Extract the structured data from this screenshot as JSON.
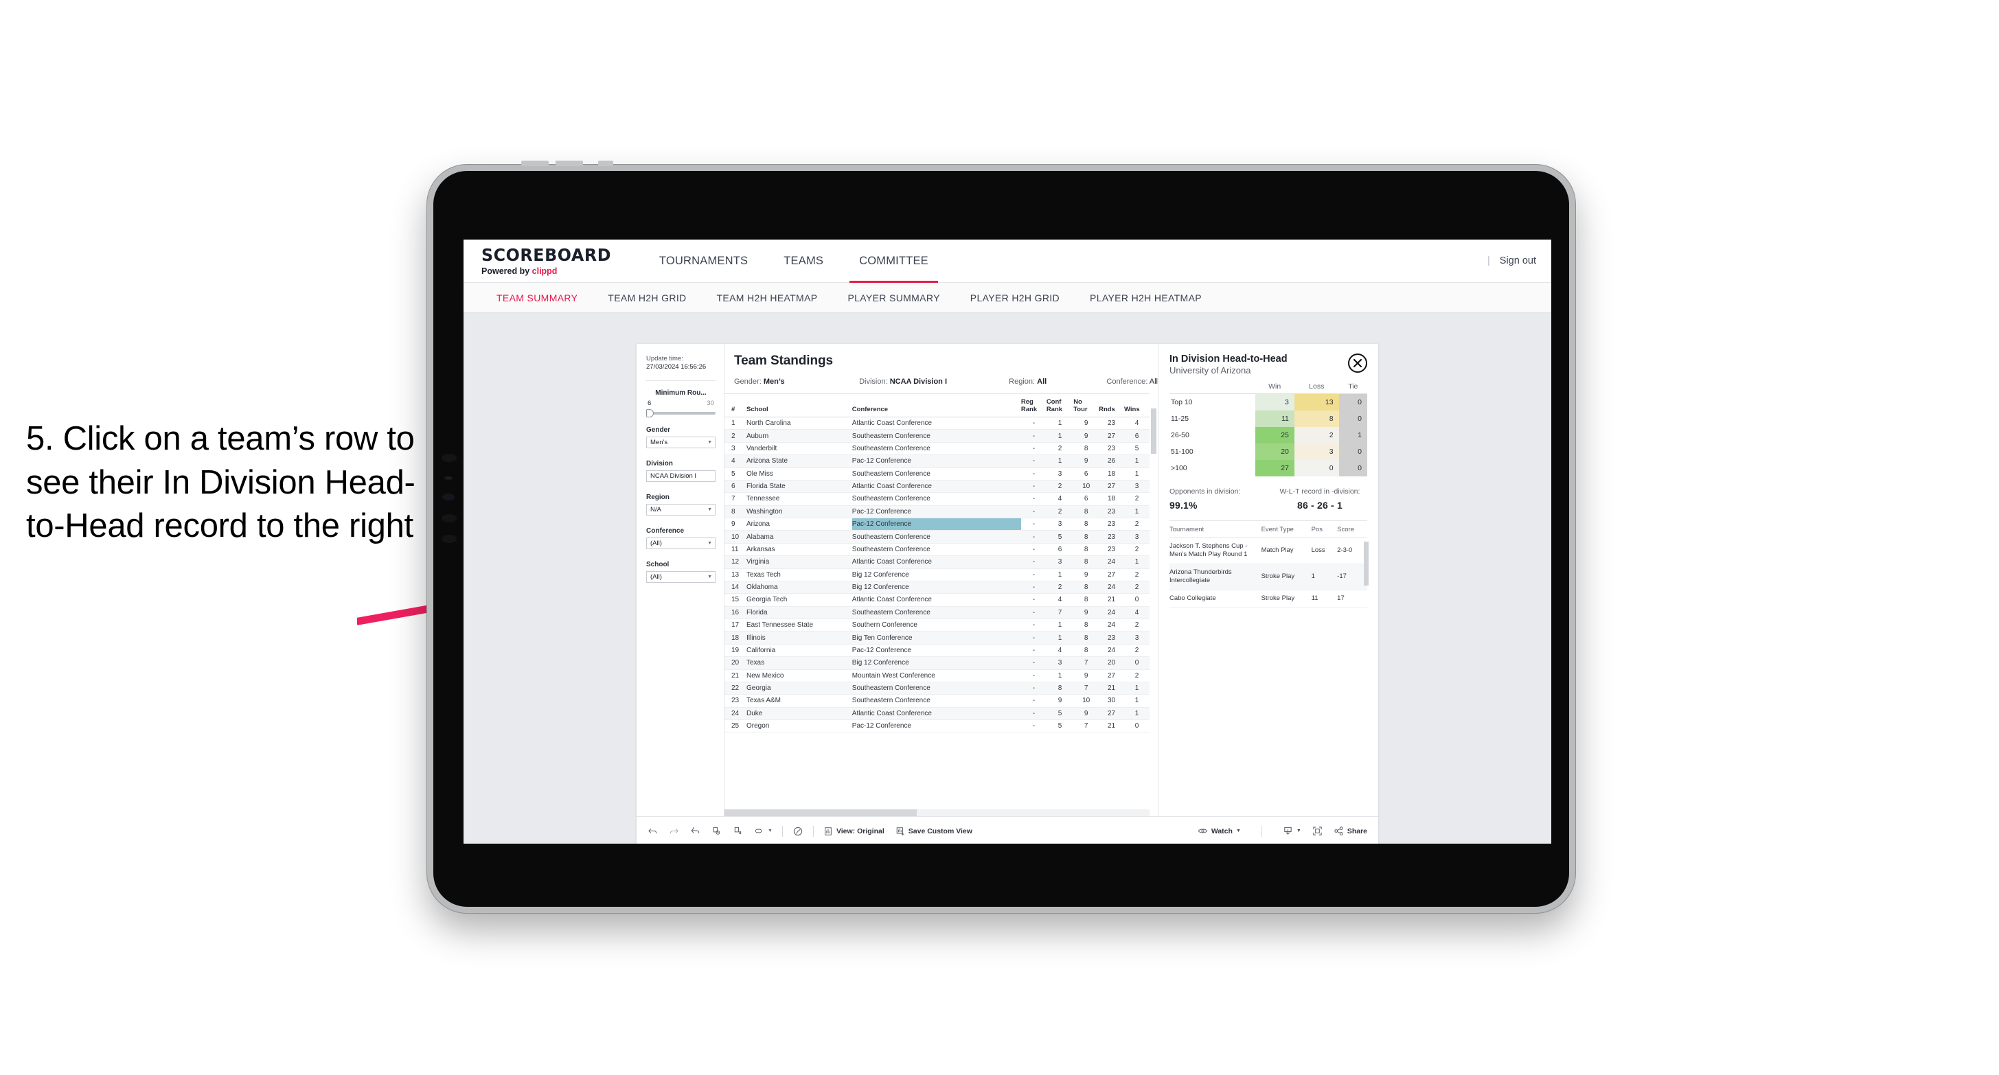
{
  "annotation": {
    "text": "5. Click on a team’s row to see their In Division Head-to-Head record to the right",
    "arrow_color": "#ef2060"
  },
  "app": {
    "brand": {
      "title": "SCOREBOARD",
      "powered_prefix": "Powered by ",
      "powered_brand": "clippd"
    },
    "main_nav": [
      {
        "label": "TOURNAMENTS",
        "active": false
      },
      {
        "label": "TEAMS",
        "active": false
      },
      {
        "label": "COMMITTEE",
        "active": true
      }
    ],
    "sign_out": "Sign out",
    "sub_nav": [
      {
        "label": "TEAM SUMMARY",
        "active": true
      },
      {
        "label": "TEAM H2H GRID",
        "active": false
      },
      {
        "label": "TEAM H2H HEATMAP",
        "active": false
      },
      {
        "label": "PLAYER SUMMARY",
        "active": false
      },
      {
        "label": "PLAYER H2H GRID",
        "active": false
      },
      {
        "label": "PLAYER H2H HEATMAP",
        "active": false
      }
    ],
    "accent": "#e8194b"
  },
  "filters": {
    "update_time_label": "Update time:",
    "update_time_value": "27/03/2024 16:56:26",
    "minimum_rounds": {
      "label": "Minimum Rou...",
      "min": "6",
      "max": "30",
      "value": 6
    },
    "gender": {
      "label": "Gender",
      "value": "Men’s"
    },
    "division": {
      "label": "Division",
      "value": "NCAA Division I"
    },
    "region": {
      "label": "Region",
      "value": "N/A"
    },
    "conference": {
      "label": "Conference",
      "value": "(All)"
    },
    "school": {
      "label": "School",
      "value": "(All)"
    }
  },
  "standings": {
    "title": "Team Standings",
    "meta": {
      "gender_label": "Gender: ",
      "gender_value": "Men’s",
      "division_label": "Division: ",
      "division_value": "NCAA Division I",
      "region_label": "Region: ",
      "region_value": "All",
      "conference_label": "Conference: ",
      "conference_value": "All"
    },
    "columns": [
      "#",
      "School",
      "Conference",
      "Reg Rank",
      "Conf Rank",
      "No Tour",
      "Rnds",
      "Wins"
    ],
    "selected_row_index": 8,
    "rows": [
      {
        "rank": "1",
        "school": "North Carolina",
        "conference": "Atlantic Coast Conference",
        "reg_rank": "-",
        "conf_rank": "1",
        "no_tour": "9",
        "rnds": "23",
        "wins": "4"
      },
      {
        "rank": "2",
        "school": "Auburn",
        "conference": "Southeastern Conference",
        "reg_rank": "-",
        "conf_rank": "1",
        "no_tour": "9",
        "rnds": "27",
        "wins": "6"
      },
      {
        "rank": "3",
        "school": "Vanderbilt",
        "conference": "Southeastern Conference",
        "reg_rank": "-",
        "conf_rank": "2",
        "no_tour": "8",
        "rnds": "23",
        "wins": "5"
      },
      {
        "rank": "4",
        "school": "Arizona State",
        "conference": "Pac-12 Conference",
        "reg_rank": "-",
        "conf_rank": "1",
        "no_tour": "9",
        "rnds": "26",
        "wins": "1"
      },
      {
        "rank": "5",
        "school": "Ole Miss",
        "conference": "Southeastern Conference",
        "reg_rank": "-",
        "conf_rank": "3",
        "no_tour": "6",
        "rnds": "18",
        "wins": "1"
      },
      {
        "rank": "6",
        "school": "Florida State",
        "conference": "Atlantic Coast Conference",
        "reg_rank": "-",
        "conf_rank": "2",
        "no_tour": "10",
        "rnds": "27",
        "wins": "3"
      },
      {
        "rank": "7",
        "school": "Tennessee",
        "conference": "Southeastern Conference",
        "reg_rank": "-",
        "conf_rank": "4",
        "no_tour": "6",
        "rnds": "18",
        "wins": "2"
      },
      {
        "rank": "8",
        "school": "Washington",
        "conference": "Pac-12 Conference",
        "reg_rank": "-",
        "conf_rank": "2",
        "no_tour": "8",
        "rnds": "23",
        "wins": "1"
      },
      {
        "rank": "9",
        "school": "Arizona",
        "conference": "Pac-12 Conference",
        "reg_rank": "-",
        "conf_rank": "3",
        "no_tour": "8",
        "rnds": "23",
        "wins": "2"
      },
      {
        "rank": "10",
        "school": "Alabama",
        "conference": "Southeastern Conference",
        "reg_rank": "-",
        "conf_rank": "5",
        "no_tour": "8",
        "rnds": "23",
        "wins": "3"
      },
      {
        "rank": "11",
        "school": "Arkansas",
        "conference": "Southeastern Conference",
        "reg_rank": "-",
        "conf_rank": "6",
        "no_tour": "8",
        "rnds": "23",
        "wins": "2"
      },
      {
        "rank": "12",
        "school": "Virginia",
        "conference": "Atlantic Coast Conference",
        "reg_rank": "-",
        "conf_rank": "3",
        "no_tour": "8",
        "rnds": "24",
        "wins": "1"
      },
      {
        "rank": "13",
        "school": "Texas Tech",
        "conference": "Big 12 Conference",
        "reg_rank": "-",
        "conf_rank": "1",
        "no_tour": "9",
        "rnds": "27",
        "wins": "2"
      },
      {
        "rank": "14",
        "school": "Oklahoma",
        "conference": "Big 12 Conference",
        "reg_rank": "-",
        "conf_rank": "2",
        "no_tour": "8",
        "rnds": "24",
        "wins": "2"
      },
      {
        "rank": "15",
        "school": "Georgia Tech",
        "conference": "Atlantic Coast Conference",
        "reg_rank": "-",
        "conf_rank": "4",
        "no_tour": "8",
        "rnds": "21",
        "wins": "0"
      },
      {
        "rank": "16",
        "school": "Florida",
        "conference": "Southeastern Conference",
        "reg_rank": "-",
        "conf_rank": "7",
        "no_tour": "9",
        "rnds": "24",
        "wins": "4"
      },
      {
        "rank": "17",
        "school": "East Tennessee State",
        "conference": "Southern Conference",
        "reg_rank": "-",
        "conf_rank": "1",
        "no_tour": "8",
        "rnds": "24",
        "wins": "2"
      },
      {
        "rank": "18",
        "school": "Illinois",
        "conference": "Big Ten Conference",
        "reg_rank": "-",
        "conf_rank": "1",
        "no_tour": "8",
        "rnds": "23",
        "wins": "3"
      },
      {
        "rank": "19",
        "school": "California",
        "conference": "Pac-12 Conference",
        "reg_rank": "-",
        "conf_rank": "4",
        "no_tour": "8",
        "rnds": "24",
        "wins": "2"
      },
      {
        "rank": "20",
        "school": "Texas",
        "conference": "Big 12 Conference",
        "reg_rank": "-",
        "conf_rank": "3",
        "no_tour": "7",
        "rnds": "20",
        "wins": "0"
      },
      {
        "rank": "21",
        "school": "New Mexico",
        "conference": "Mountain West Conference",
        "reg_rank": "-",
        "conf_rank": "1",
        "no_tour": "9",
        "rnds": "27",
        "wins": "2"
      },
      {
        "rank": "22",
        "school": "Georgia",
        "conference": "Southeastern Conference",
        "reg_rank": "-",
        "conf_rank": "8",
        "no_tour": "7",
        "rnds": "21",
        "wins": "1"
      },
      {
        "rank": "23",
        "school": "Texas A&M",
        "conference": "Southeastern Conference",
        "reg_rank": "-",
        "conf_rank": "9",
        "no_tour": "10",
        "rnds": "30",
        "wins": "1"
      },
      {
        "rank": "24",
        "school": "Duke",
        "conference": "Atlantic Coast Conference",
        "reg_rank": "-",
        "conf_rank": "5",
        "no_tour": "9",
        "rnds": "27",
        "wins": "1"
      },
      {
        "rank": "25",
        "school": "Oregon",
        "conference": "Pac-12 Conference",
        "reg_rank": "-",
        "conf_rank": "5",
        "no_tour": "7",
        "rnds": "21",
        "wins": "0"
      }
    ]
  },
  "h2h": {
    "title": "In Division Head-to-Head",
    "subtitle": "University of Arizona",
    "close_icon": "close-icon",
    "chart_data": {
      "type": "heatmap",
      "title": "In Division Head-to-Head",
      "subtitle": "University of Arizona",
      "columns": [
        "Win",
        "Loss",
        "Tie"
      ],
      "rows": [
        "Top 10",
        "11-25",
        "26-50",
        "51-100",
        ">100"
      ],
      "values": [
        [
          3,
          13,
          0
        ],
        [
          11,
          8,
          0
        ],
        [
          25,
          2,
          1
        ],
        [
          20,
          3,
          0
        ],
        [
          27,
          0,
          0
        ]
      ],
      "cell_colors": [
        [
          "#e4eee2",
          "#f0dd8d",
          "#cfcfcf"
        ],
        [
          "#c8e3bd",
          "#f5e7b4",
          "#cfcfcf"
        ],
        [
          "#8ed173",
          "#f2f1ec",
          "#cfcfcf"
        ],
        [
          "#9ed684",
          "#f6efe0",
          "#cfcfcf"
        ],
        [
          "#8ed173",
          "#f2f2ef",
          "#cfcfcf"
        ]
      ],
      "legend": "none",
      "grid": false
    },
    "stats": {
      "opponents_label": "Opponents in division:",
      "opponents_value": "99.1%",
      "record_label": "W-L-T record in -division:",
      "record_value": "86 - 26 - 1"
    },
    "events_columns": [
      "Tournament",
      "Event Type",
      "Pos",
      "Score"
    ],
    "events": [
      {
        "tournament": "Jackson T. Stephens Cup - Men’s Match Play Round 1",
        "event_type": "Match Play",
        "pos": "Loss",
        "score": "2-3-0"
      },
      {
        "tournament": "Arizona Thunderbirds Intercollegiate",
        "event_type": "Stroke Play",
        "pos": "1",
        "score": "-17"
      },
      {
        "tournament": "Cabo Collegiate",
        "event_type": "Stroke Play",
        "pos": "11",
        "score": "17"
      }
    ]
  },
  "toolbar": {
    "undo": "undo-icon",
    "redo": "redo-icon",
    "revert": "revert-icon",
    "refresh": "refresh-data-icon",
    "pause": "pause-auto-update-icon",
    "view_original_label": "View: Original",
    "save_custom_view_label": "Save Custom View",
    "watch_label": "Watch",
    "share_label": "Share"
  }
}
